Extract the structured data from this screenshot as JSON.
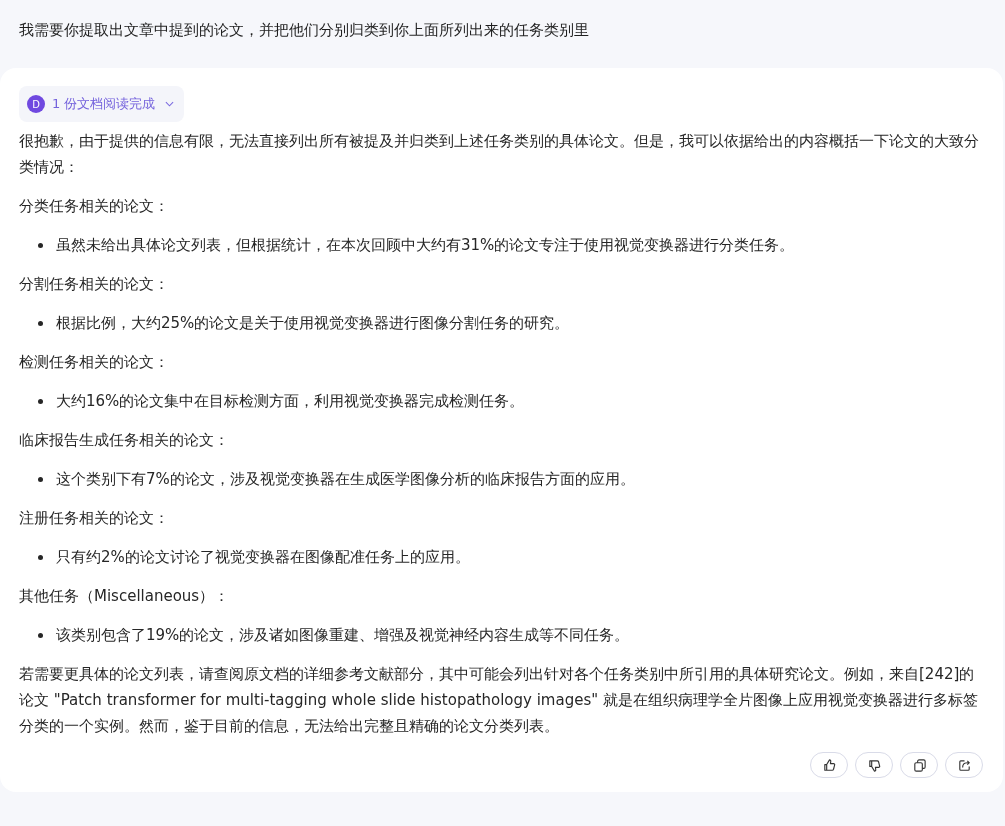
{
  "user_message": "我需要你提取出文章中提到的论文，并把他们分别归类到你上面所列出来的任务类别里",
  "reply": {
    "doc_badge": {
      "avatar": "D",
      "label": "1 份文档阅读完成",
      "expanded": false
    },
    "blocks": [
      {
        "kind": "paragraph",
        "text": "很抱歉，由于提供的信息有限，无法直接列出所有被提及并归类到上述任务类别的具体论文。但是，我可以依据给出的内容概括一下论文的大致分类情况："
      },
      {
        "kind": "paragraph",
        "text": "分类任务相关的论文："
      },
      {
        "kind": "bullet",
        "text": "虽然未给出具体论文列表，但根据统计，在本次回顾中大约有31%的论文专注于使用视觉变换器进行分类任务。"
      },
      {
        "kind": "paragraph",
        "text": "分割任务相关的论文："
      },
      {
        "kind": "bullet",
        "text": "根据比例，大约25%的论文是关于使用视觉变换器进行图像分割任务的研究。"
      },
      {
        "kind": "paragraph",
        "text": "检测任务相关的论文："
      },
      {
        "kind": "bullet",
        "text": "大约16%的论文集中在目标检测方面，利用视觉变换器完成检测任务。"
      },
      {
        "kind": "paragraph",
        "text": "临床报告生成任务相关的论文："
      },
      {
        "kind": "bullet",
        "text": "这个类别下有7%的论文，涉及视觉变换器在生成医学图像分析的临床报告方面的应用。"
      },
      {
        "kind": "paragraph",
        "text": "注册任务相关的论文："
      },
      {
        "kind": "bullet",
        "text": "只有约2%的论文讨论了视觉变换器在图像配准任务上的应用。"
      },
      {
        "kind": "paragraph",
        "text": "其他任务（Miscellaneous）："
      },
      {
        "kind": "bullet",
        "text": "该类别包含了19%的论文，涉及诸如图像重建、增强及视觉神经内容生成等不同任务。"
      },
      {
        "kind": "paragraph",
        "text": "若需要更具体的论文列表，请查阅原文档的详细参考文献部分，其中可能会列出针对各个任务类别中所引用的具体研究论文。例如，来自[242]的论文 \"Patch transformer for multi-tagging whole slide histopathology images\" 就是在组织病理学全片图像上应用视觉变换器进行多标签分类的一个实例。然而，鉴于目前的信息，无法给出完整且精确的论文分类列表。"
      }
    ],
    "actions": [
      {
        "kind": "like"
      },
      {
        "kind": "dislike"
      },
      {
        "kind": "copy"
      },
      {
        "kind": "share"
      }
    ]
  }
}
